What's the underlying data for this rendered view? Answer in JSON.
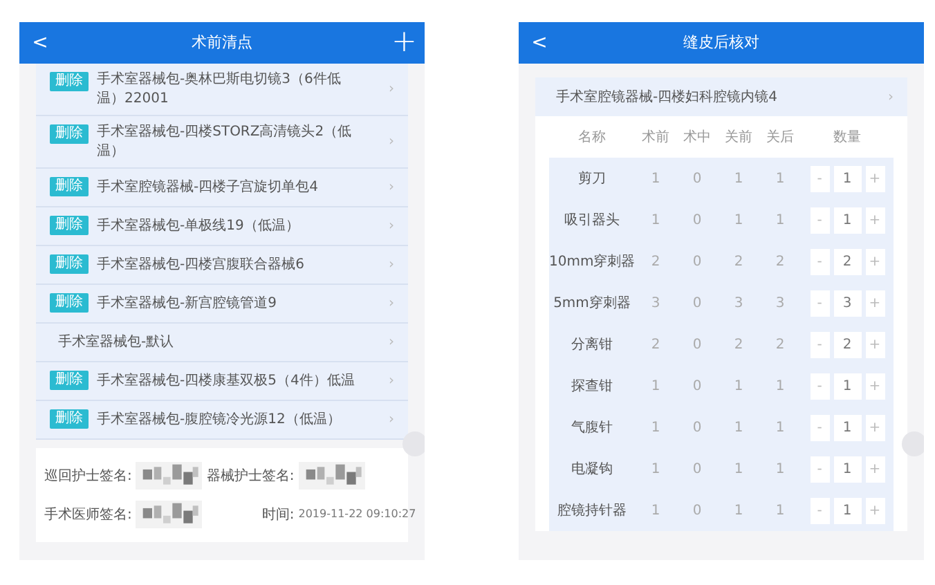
{
  "left_screen": {
    "title": "术前清点",
    "back": "<",
    "add": "+",
    "items": [
      {
        "deletable": true,
        "delete_label": "删除",
        "text": "手术室器械包-奥林巴斯电切镜3（6件低温）22001"
      },
      {
        "deletable": true,
        "delete_label": "删除",
        "text": "手术室器械包-四楼STORZ高清镜头2（低温）"
      },
      {
        "deletable": true,
        "delete_label": "删除",
        "text": "手术室腔镜器械-四楼子宫旋切单包4"
      },
      {
        "deletable": true,
        "delete_label": "删除",
        "text": "手术室器械包-单极线19（低温）"
      },
      {
        "deletable": true,
        "delete_label": "删除",
        "text": "手术室器械包-四楼宫腹联合器械6"
      },
      {
        "deletable": true,
        "delete_label": "删除",
        "text": "手术室器械包-新宫腔镜管道9"
      },
      {
        "deletable": false,
        "text": "手术室器械包-默认"
      },
      {
        "deletable": true,
        "delete_label": "删除",
        "text": "手术室器械包-四楼康基双极5（4件）低温"
      },
      {
        "deletable": true,
        "delete_label": "删除",
        "text": "手术室器械包-腹腔镜冷光源12（低温）"
      }
    ],
    "chevron": "›",
    "signatures": {
      "circulating_nurse": "巡回护士签名:",
      "scrub_nurse": "器械护士签名:",
      "surgeon": "手术医师签名:",
      "time_label": "时间:",
      "time": "2019-11-22 09:10:27"
    }
  },
  "right_screen": {
    "title": "缝皮后核对",
    "back": "<",
    "package": "手术室腔镜器械-四楼妇科腔镜内镜4",
    "columns": [
      "名称",
      "术前",
      "术中",
      "关前",
      "关后",
      "数量"
    ],
    "rows": [
      {
        "name": "剪刀",
        "pre": "1",
        "intra": "0",
        "before_close": "1",
        "after_close": "1",
        "qty": "1"
      },
      {
        "name": "吸引器头",
        "pre": "1",
        "intra": "0",
        "before_close": "1",
        "after_close": "1",
        "qty": "1"
      },
      {
        "name": "10mm穿刺器",
        "pre": "2",
        "intra": "0",
        "before_close": "2",
        "after_close": "2",
        "qty": "2"
      },
      {
        "name": "5mm穿刺器",
        "pre": "3",
        "intra": "0",
        "before_close": "3",
        "after_close": "3",
        "qty": "3"
      },
      {
        "name": "分离钳",
        "pre": "2",
        "intra": "0",
        "before_close": "2",
        "after_close": "2",
        "qty": "2"
      },
      {
        "name": "探查钳",
        "pre": "1",
        "intra": "0",
        "before_close": "1",
        "after_close": "1",
        "qty": "1"
      },
      {
        "name": "气腹针",
        "pre": "1",
        "intra": "0",
        "before_close": "1",
        "after_close": "1",
        "qty": "1"
      },
      {
        "name": "电凝钩",
        "pre": "1",
        "intra": "0",
        "before_close": "1",
        "after_close": "1",
        "qty": "1"
      },
      {
        "name": "腔镜持针器",
        "pre": "1",
        "intra": "0",
        "before_close": "1",
        "after_close": "1",
        "qty": "1"
      }
    ],
    "chevron": "›",
    "minus": "-",
    "plus": "+"
  }
}
